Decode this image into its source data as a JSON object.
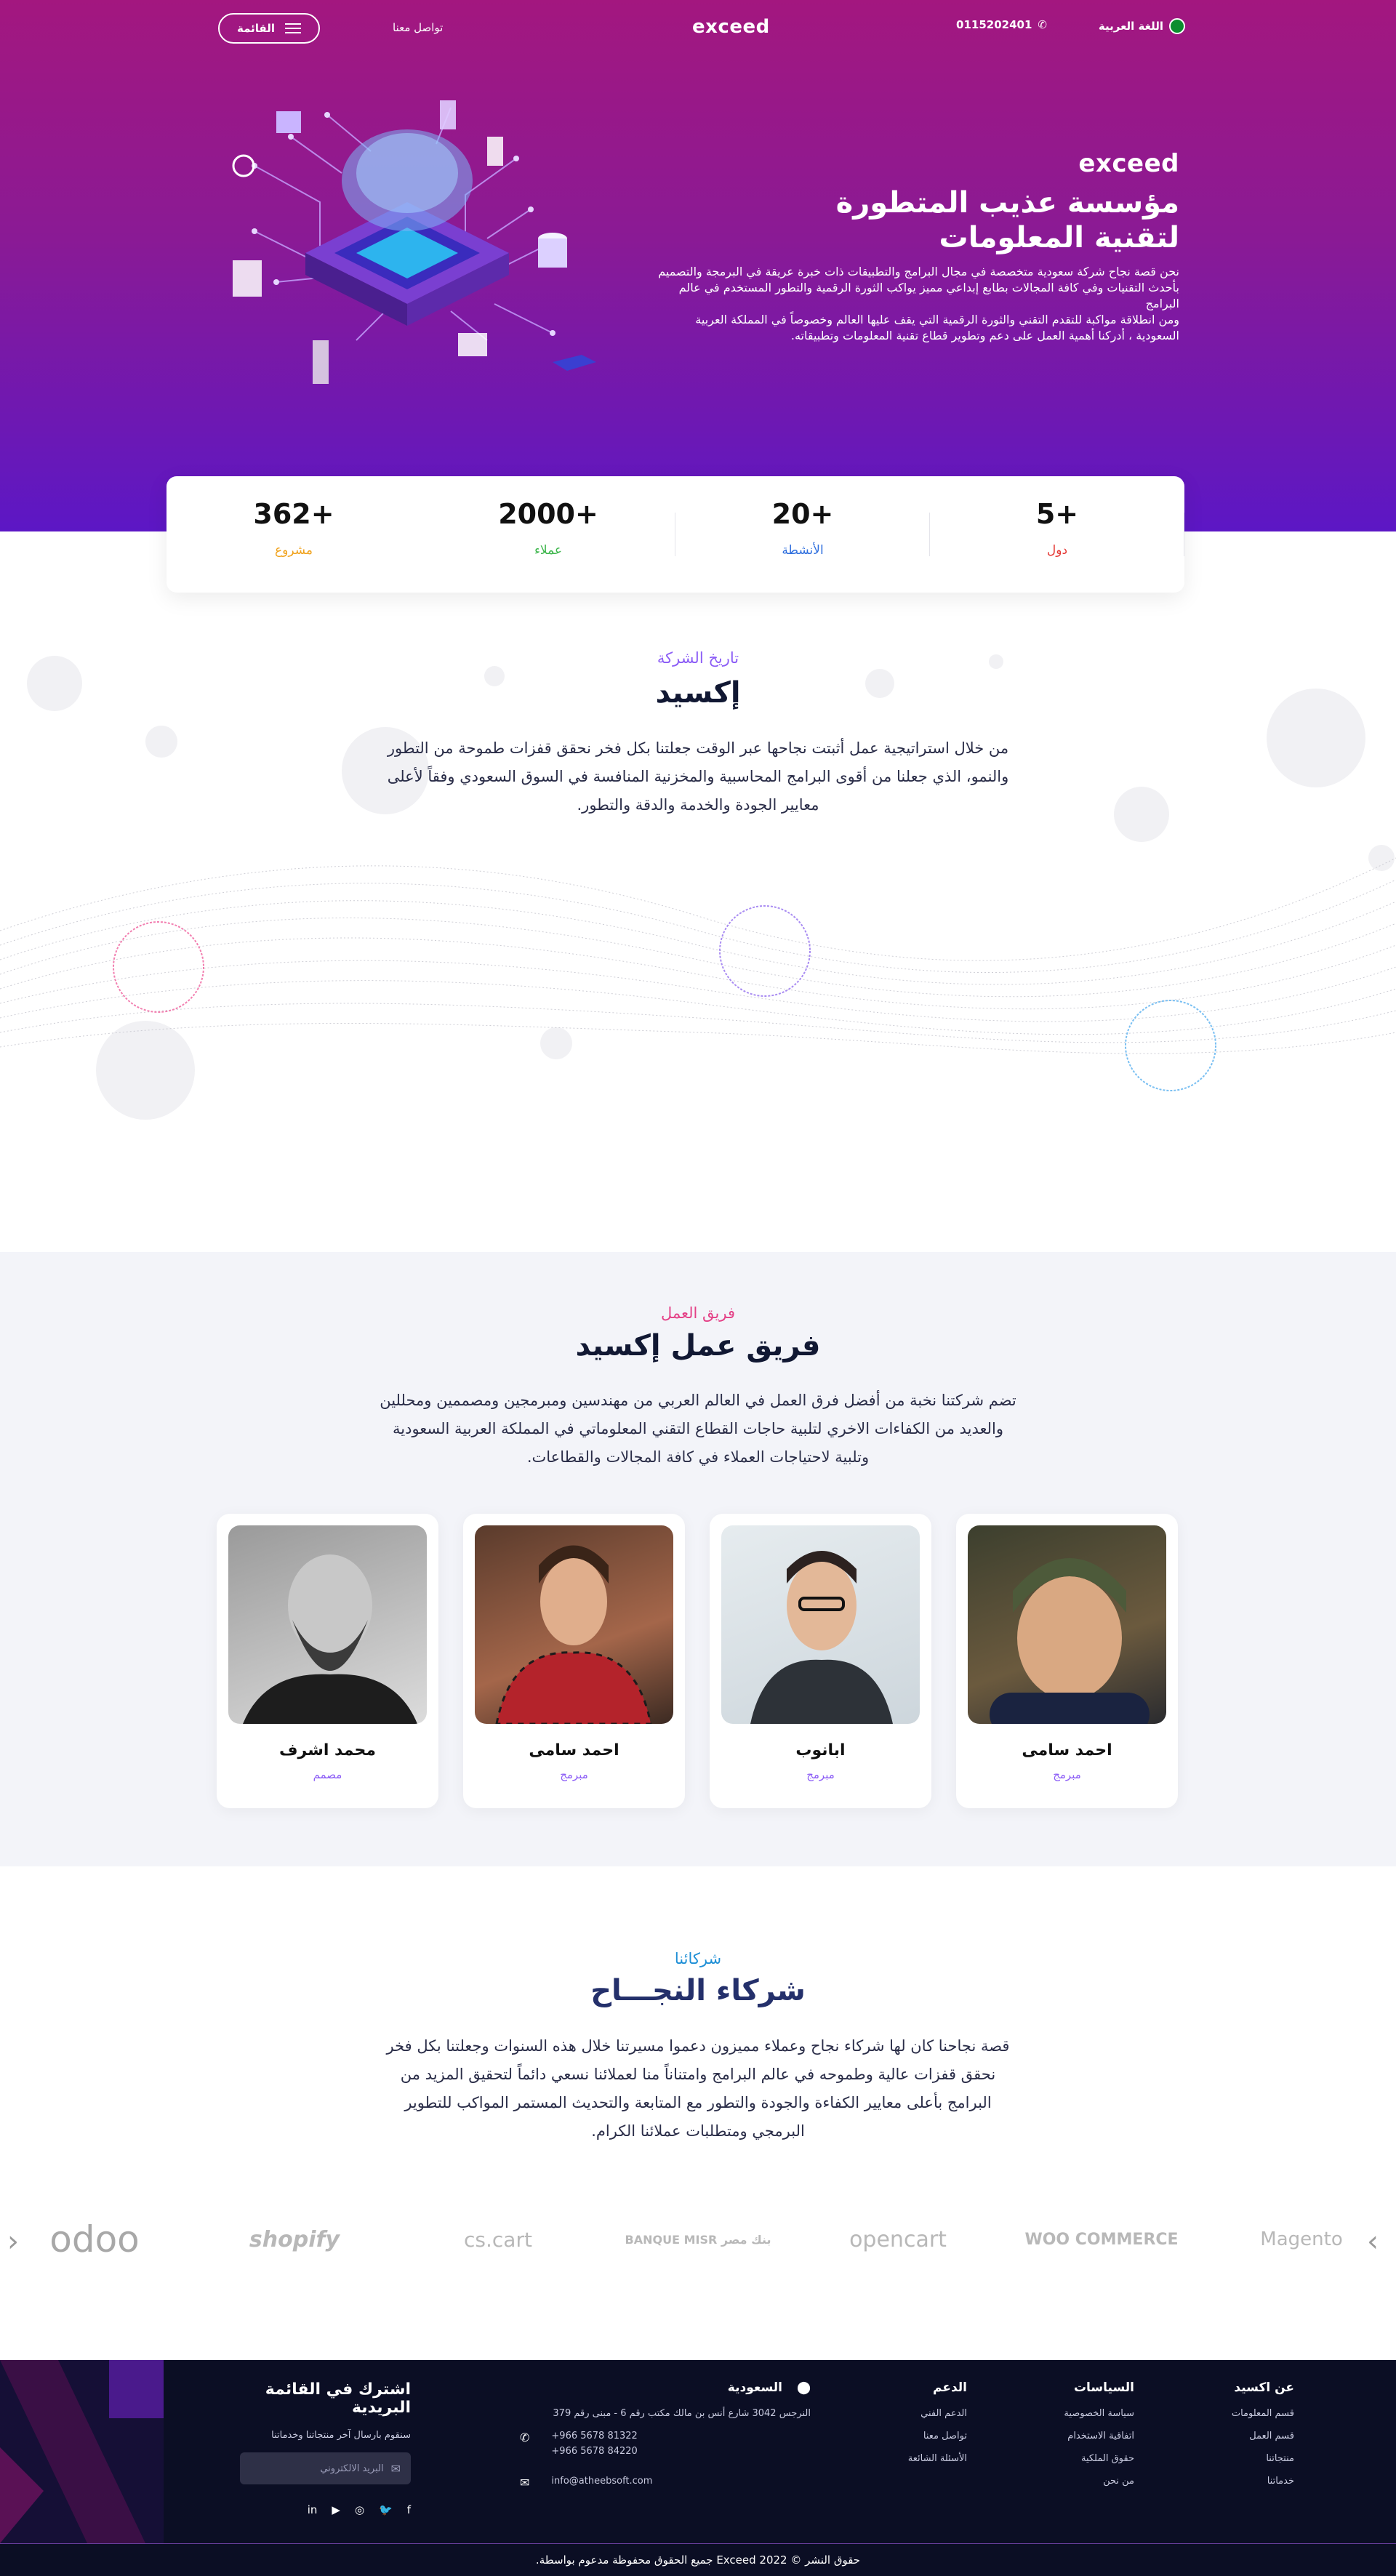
{
  "header": {
    "menu_label": "القائمة",
    "contact_label": "تواصل معنا",
    "logo": "exceed",
    "phone": "0115202401",
    "language": "اللغة العربية"
  },
  "hero": {
    "logo": "exceed",
    "title_line1": "مؤسسة عذيب المتطورة",
    "title_line2": "لتقنية المعلومات",
    "desc1": "نحن قصة نجاح شركة سعودية متخصصة في مجال البرامج والتطبيقات ذات خبرة عريقة في البرمجة والتصميم بأحدث التقنيات وفي كافة المجالات بطابع إبداعي مميز يواكب الثورة الرقمية والتطور المستخدم في عالم البرامج",
    "desc2": "ومن انطلاقة مواكبة للتقدم التقني والثورة الرقمية التي يقف عليها العالم وخصوصاً في المملكة العربية السعودية ، أدركنا أهمية العمل على دعم وتطوير قطاع تقنية المعلومات وتطبيقاته."
  },
  "stats": [
    {
      "value": "362+",
      "label": "مشروع",
      "color": "#f0a21c"
    },
    {
      "value": "2000+",
      "label": "عملاء",
      "color": "#3bb54a"
    },
    {
      "value": "20+",
      "label": "الأنشطة",
      "color": "#2f6fde"
    },
    {
      "value": "5+",
      "label": "دول",
      "color": "#e53935"
    }
  ],
  "history": {
    "subtitle": "تاريخ الشركة",
    "title": "إكسيد",
    "body": "من خلال استراتيجية عمل أثبتت نجاحها عبر الوقت جعلتنا بكل فخر نحقق قفزات طموحة من التطور والنمو، الذي جعلنا من أقوى البرامج المحاسبية والمخزنية المنافسة في السوق السعودي وفقاً لأعلى معايير الجودة والخدمة والدقة والتطور."
  },
  "team": {
    "subtitle": "فريق العمل",
    "title": "فريق عمل إكسيد",
    "body": "تضم شركتنا نخبة من أفضل فرق العمل في العالم العربي من مهندسين ومبرمجين ومصممين ومحللين والعديد من الكفاءات الاخري لتلبية حاجات القطاع التقني المعلوماتي في المملكة العربية السعودية وتلبية لاحتياجات العملاء في كافة المجالات والقطاعات.",
    "members": [
      {
        "name": "احمد سامى",
        "role": "مبرمج"
      },
      {
        "name": "ابانوب",
        "role": "مبرمج"
      },
      {
        "name": "احمد سامى",
        "role": "مبرمج"
      },
      {
        "name": "محمد اشرف",
        "role": "مصمم"
      }
    ]
  },
  "partners": {
    "subtitle": "شركائنا",
    "title": "شركاء النجـــاح",
    "body": "قصة نجاحنا كان لها شركاء نجاح وعملاء مميزون دعموا مسيرتنا خلال هذه السنوات وجعلتنا بكل فخر نحقق قفزات عالية وطموحه في عالم البرامج وامتناناً منا لعملائنا نسعي دائماً لتحقيق المزيد من البرامج بأعلى معايير الكفاءة والجودة والتطور مع المتابعة والتحديث المستمر المواكب للتطوير البرمجي ومتطلبات عملائنا الكرام.",
    "logos": [
      "Magento",
      "WOO COMMERCE",
      "opencart",
      "بنك مصر BANQUE MISR",
      "cs.cart",
      "shopify",
      "odoo"
    ]
  },
  "footer": {
    "about": {
      "title": "عن اكسيد",
      "links": [
        "قسم المعلومات",
        "قسم العمل",
        "منتجاتنا",
        "خدماتنا"
      ]
    },
    "policies": {
      "title": "السياسات",
      "links": [
        "سياسة الخصوصية",
        "اتفاقية الاستخدام",
        "حقوق الملكية",
        "من نحن"
      ]
    },
    "support": {
      "title": "الدعم",
      "links": [
        "الدعم الفني",
        "تواصل معنا",
        "الأسئلة الشائعة"
      ]
    },
    "contact": {
      "title": "السعودية",
      "address": "النرجس 3042 شارع أنس بن مالك مكتب رقم 6 - مبنى رقم 379",
      "phone1": "+966 5678 81322",
      "phone2": "+966 5678 84220",
      "email": "info@atheebsoft.com"
    },
    "newsletter": {
      "title": "اشترك في القائمة البريدية",
      "desc": "سنقوم بارسال آخر منتجاتنا وخدماتنا",
      "placeholder": "البريد الالكتروني"
    },
    "copyright": "حقوق النشر © Exceed 2022 جميع الحقوق محفوظة مدعوم بواسطة."
  }
}
